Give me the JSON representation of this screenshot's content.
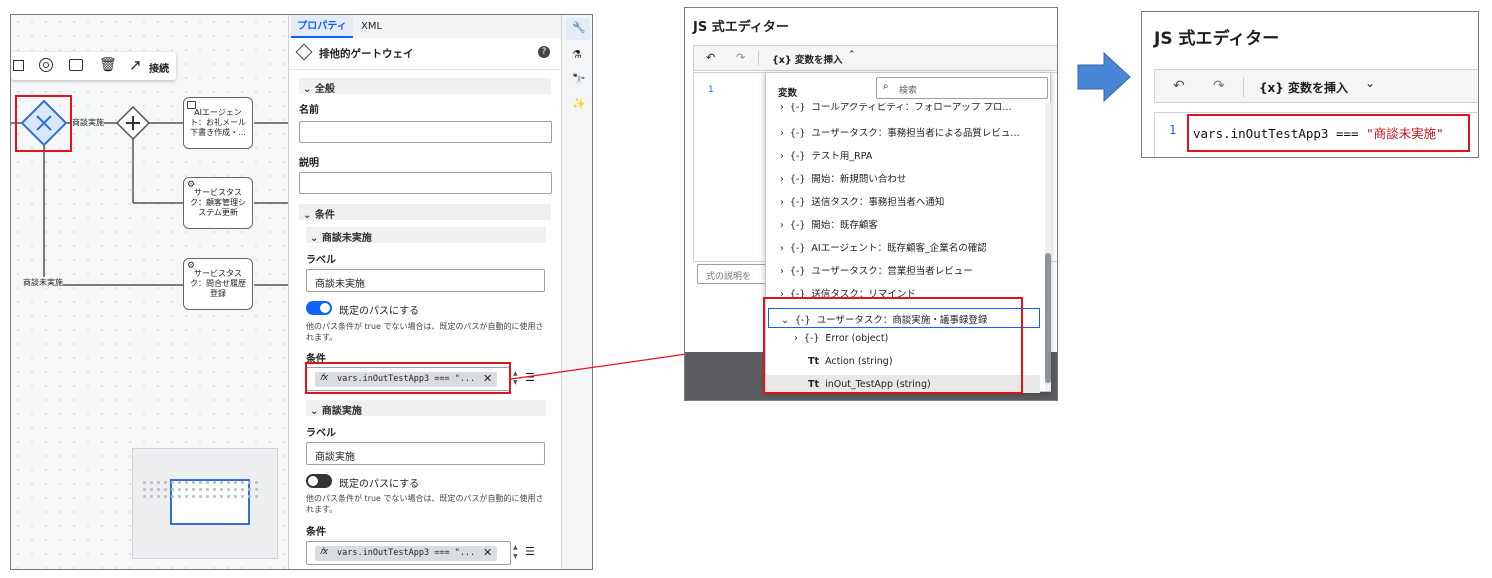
{
  "panel1": {
    "toolbar": {
      "connect_label": "接続"
    },
    "tabs": [
      {
        "label": "プロパティ"
      },
      {
        "label": "XML"
      }
    ],
    "element_title": "排他的ゲートウェイ",
    "diagram": {
      "edge_to_gateway_label": "商談実施",
      "edge_no_label": "商談未実施",
      "task_ai": "AIエージェント：お礼メール下書き作成・...",
      "task_service1": "サービスタスク：顧客管理システム更新",
      "task_service2": "サービスタスク：問合せ履歴登録"
    },
    "general_section": "全般",
    "name_label": "名前",
    "name_value": "",
    "desc_label": "説明",
    "desc_value": "",
    "conditions_section": "条件",
    "cond1": {
      "header": "商談未実施",
      "label_caption": "ラベル",
      "label_value": "商談未実施",
      "default_toggle_label": "既定のパスにする",
      "default_on": true,
      "help": "他のパス条件が true でない場合は、既定のパスが自動的に使用されます。",
      "condition_caption": "条件",
      "expression": "vars.inOutTestApp3 === \"..."
    },
    "cond2": {
      "header": "商談実施",
      "label_caption": "ラベル",
      "label_value": "商談実施",
      "default_toggle_label": "既定のパスにする",
      "default_on": false,
      "help": "他のパス条件が true でない場合は、既定のパスが自動的に使用されます。",
      "condition_caption": "条件",
      "expression": "vars.inOutTestApp3 === \"..."
    }
  },
  "panel2": {
    "title": "JS 式エディター",
    "insert_var_label": "{x} 変数を挿入",
    "line_number": "1",
    "desc_placeholder": "式の説明を",
    "dropdown": {
      "header": "変数",
      "search_placeholder": "検索",
      "items": [
        "ゴールアクティビティ：フォローアップ プロ...",
        "ユーザータスク：事務担当者による品質レビュ...",
        "テスト用_RPA",
        "開始：新規問い合わせ",
        "送信タスク：事務担当者へ通知",
        "開始：既存顧客",
        "AIエージェント：既存顧客_企業名の確認",
        "ユーザータスク：営業担当者レビュー",
        "送信タスク：リマインド"
      ],
      "expanded_item": "ユーザータスク：商談実施・議事録登録",
      "children": [
        {
          "type": "{-}",
          "label": "Error (object)"
        },
        {
          "type": "Tt",
          "label": "Action (string)"
        },
        {
          "type": "Tt",
          "label": "inOut_TestApp (string)"
        }
      ]
    }
  },
  "panel3": {
    "title": "JS 式エディター",
    "insert_var_label": "{x} 変数を挿入",
    "line_number": "1",
    "code_prefix": "vars.inOutTestApp3 === ",
    "code_string": "\"商談未実施\""
  },
  "colors": {
    "accent": "#0f62fe",
    "red": "#e0141b",
    "arrow": "#4a86d6"
  }
}
